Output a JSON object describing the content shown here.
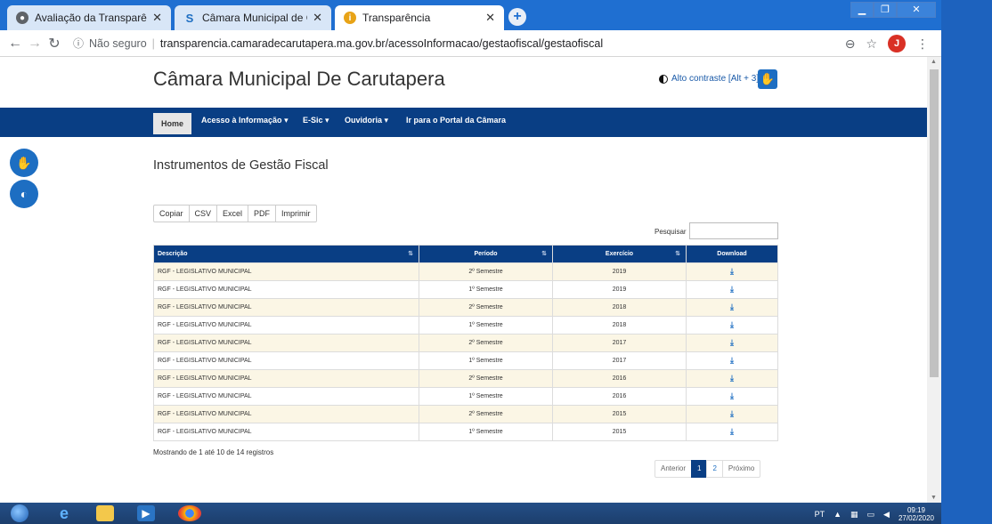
{
  "browser": {
    "tabs": [
      {
        "label": "Avaliação da Transparência dos J",
        "icon": "globe-icon",
        "active": false
      },
      {
        "label": "Câmara Municipal de Carutapera",
        "icon": "site-s-icon",
        "active": false
      },
      {
        "label": "Transparência",
        "icon": "info-icon",
        "active": true
      }
    ],
    "new_tab": "+",
    "url": {
      "security": "Não seguro",
      "address": "transparencia.camaradecarutapera.ma.gov.br/acessoInformacao/gestaofiscal/gestaofiscal"
    },
    "profile_initial": "J"
  },
  "site": {
    "title": "Câmara Municipal De Carutapera",
    "contrast_link": "Alto contraste [Alt + 3]"
  },
  "navbar": {
    "home": "Home",
    "items": [
      {
        "label": "Acesso à Informação",
        "has_dropdown": true
      },
      {
        "label": "E-Sic",
        "has_dropdown": true
      },
      {
        "label": "Ouvidoria",
        "has_dropdown": true
      },
      {
        "label": "Ir para o Portal da Câmara",
        "has_dropdown": false
      }
    ]
  },
  "main": {
    "section_title": "Instrumentos de Gestão Fiscal",
    "export_buttons": [
      "Copiar",
      "CSV",
      "Excel",
      "PDF",
      "Imprimir"
    ],
    "search_label": "Pesquisar",
    "search_value": ""
  },
  "table": {
    "headers": [
      "Descrição",
      "Período",
      "Exercício",
      "Download"
    ],
    "rows": [
      [
        "RGF - LEGISLATIVO MUNICIPAL",
        "2º Semestre",
        "2019"
      ],
      [
        "RGF - LEGISLATIVO MUNICIPAL",
        "1º Semestre",
        "2019"
      ],
      [
        "RGF - LEGISLATIVO MUNICIPAL",
        "2º Semestre",
        "2018"
      ],
      [
        "RGF - LEGISLATIVO MUNICIPAL",
        "1º Semestre",
        "2018"
      ],
      [
        "RGF - LEGISLATIVO MUNICIPAL",
        "2º Semestre",
        "2017"
      ],
      [
        "RGF - LEGISLATIVO MUNICIPAL",
        "1º Semestre",
        "2017"
      ],
      [
        "RGF - LEGISLATIVO MUNICIPAL",
        "2º Semestre",
        "2016"
      ],
      [
        "RGF - LEGISLATIVO MUNICIPAL",
        "1º Semestre",
        "2016"
      ],
      [
        "RGF - LEGISLATIVO MUNICIPAL",
        "2º Semestre",
        "2015"
      ],
      [
        "RGF - LEGISLATIVO MUNICIPAL",
        "1º Semestre",
        "2015"
      ]
    ]
  },
  "footer": {
    "info": "Mostrando de 1 até 10 de 14 registros",
    "pagination": {
      "prev": "Anterior",
      "pages": [
        "1",
        "2"
      ],
      "current": "1",
      "next": "Próximo"
    }
  },
  "taskbar": {
    "language": "PT",
    "time": "09:19",
    "date": "27/02/2020"
  },
  "colors": {
    "navbar": "#093e84",
    "accent": "#1d6ec2",
    "row_stripe": "#fbf6e5",
    "tabbar": "#1f6fd1"
  }
}
